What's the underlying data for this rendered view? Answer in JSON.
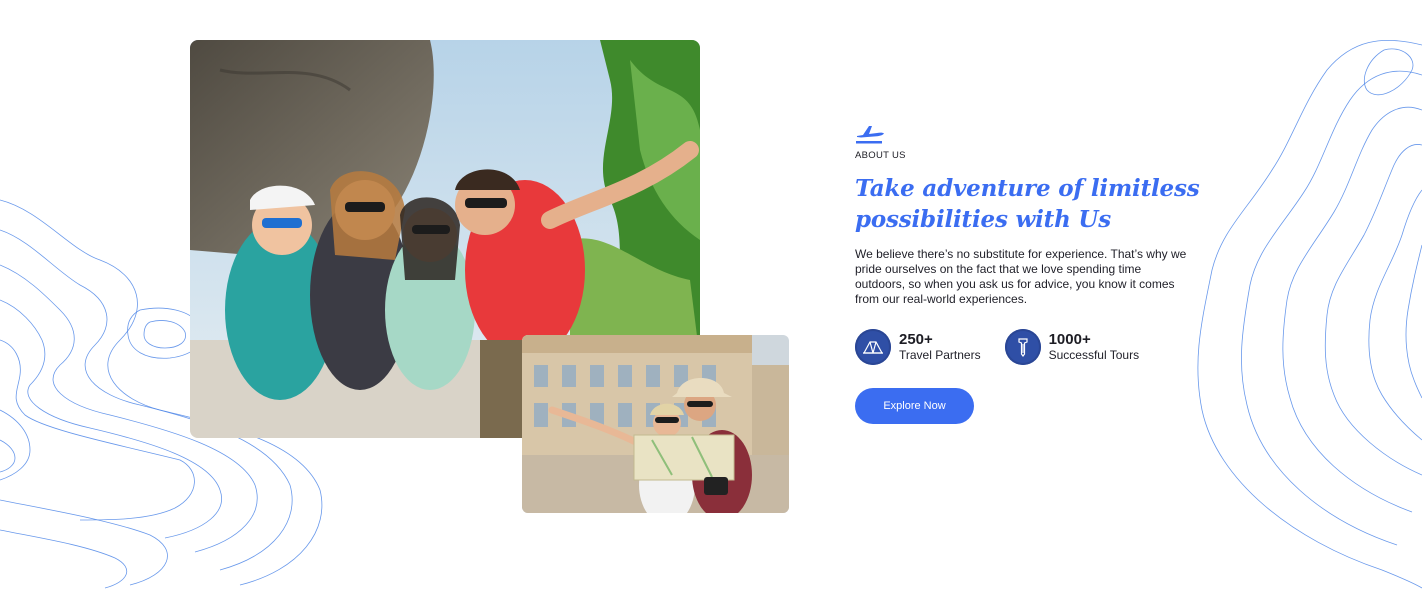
{
  "about": {
    "eyebrow": "ABOUT US",
    "headline": "Take adventure of limitless possibilities with Us",
    "description": "We believe there’s no substitute for experience. That’s why we pride ourselves on the fact that we love spending time outdoors, so when you ask us for advice, you know it comes from our real-world experiences."
  },
  "stats": [
    {
      "icon": "tent-icon",
      "value": "250+",
      "label": "Travel Partners"
    },
    {
      "icon": "compass-tool-icon",
      "value": "1000+",
      "label": "Successful Tours"
    }
  ],
  "cta": {
    "label": "Explore Now"
  },
  "images": {
    "main": "group-of-friends-selfie-photo",
    "secondary": "couple-reading-map-photo"
  },
  "colors": {
    "accent": "#3b6df1",
    "icon_bg": "#2f4fa6",
    "topo_line": "#4d86e8",
    "text": "#1d1d24"
  }
}
